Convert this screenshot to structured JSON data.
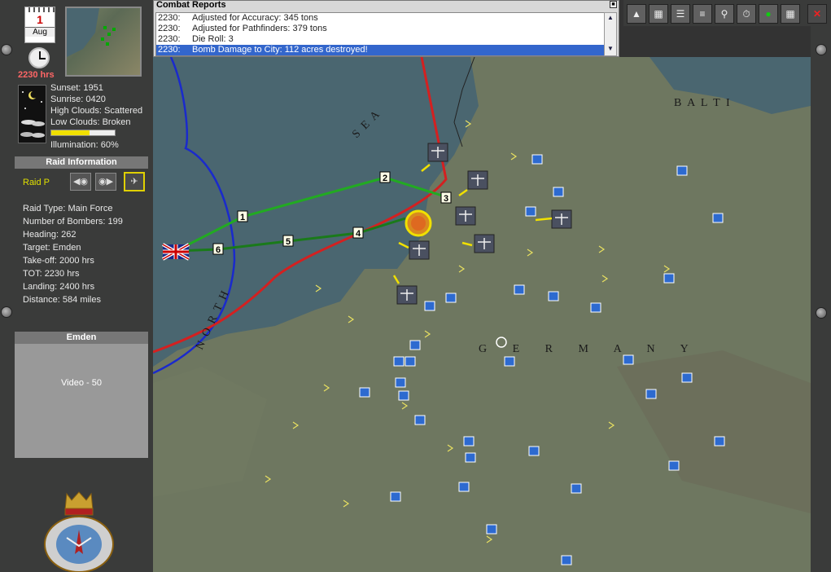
{
  "sidebar": {
    "calendar": {
      "day": "1",
      "month": "Aug"
    },
    "time": "2230 hrs",
    "weather": {
      "sunset": "Sunset: 1951",
      "sunrise": "Sunrise: 0420",
      "high_clouds": "High Clouds: Scattered",
      "low_clouds": "Low Clouds: Broken",
      "illumination": "Illumination:  60%",
      "illumination_level": 0.6
    },
    "raid_header": "Raid Information",
    "raid_name": "Raid P",
    "raid_info": [
      "Raid Type: Main Force",
      "Number of Bombers:  199",
      "Heading:  262",
      "Target: Emden",
      "Take-off:           2000 hrs",
      "TOT:                   2230 hrs",
      "Landing:             2400 hrs",
      "Distance:  584 miles"
    ],
    "target_header": "Emden",
    "video_label": "Video -  50",
    "crest_text": "BOMBER COMMAND"
  },
  "reports": {
    "title": "Combat Reports",
    "rows": [
      {
        "time": "2230:",
        "text": "Adjusted for Accuracy:  345 tons"
      },
      {
        "time": "2230:",
        "text": "Adjusted for Pathfinders:  379 tons"
      },
      {
        "time": "2230:",
        "text": "Die Roll:  3"
      },
      {
        "time": "2230:",
        "text": "Bomb Damage to City:  112 acres destroyed!"
      }
    ]
  },
  "toolbar": {
    "icons": [
      "parachute-icon",
      "save-icon",
      "report-icon",
      "list-icon",
      "zoom-icon",
      "stopwatch-icon",
      "go-icon",
      "grid-icon",
      "close-icon"
    ]
  },
  "map": {
    "sea_label_north": "N O R T H",
    "sea_label_sea": "S E A",
    "baltic_label": "B A L T I",
    "germany_label": "G E R M A N Y",
    "waypoints": [
      "1",
      "2",
      "3",
      "4",
      "5",
      "6"
    ],
    "colors": {
      "outbound": "#22aa22",
      "inbound": "#1a7a1a",
      "red_line": "#d42020",
      "blue_line": "#1a2acc",
      "sea": "#4a6670",
      "land": "#6e7760"
    }
  }
}
